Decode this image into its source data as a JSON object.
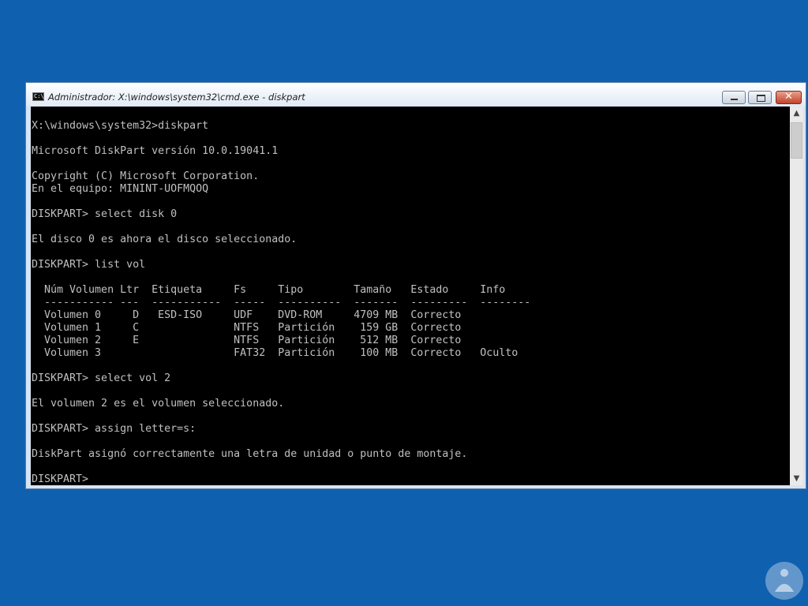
{
  "window": {
    "title": "Administrador: X:\\windows\\system32\\cmd.exe - diskpart",
    "icon_label": "C:\\"
  },
  "console": {
    "lines": [
      {
        "row": 0,
        "text": "X:\\windows\\system32>diskpart"
      },
      {
        "row": 2,
        "text": "Microsoft DiskPart versión 10.0.19041.1"
      },
      {
        "row": 4,
        "text": "Copyright (C) Microsoft Corporation."
      },
      {
        "row": 5,
        "text": "En el equipo: MININT-UOFMQOQ"
      },
      {
        "row": 7,
        "text": "DISKPART> select disk 0"
      },
      {
        "row": 9,
        "text": "El disco 0 es ahora el disco seleccionado."
      },
      {
        "row": 11,
        "text": "DISKPART> list vol"
      },
      {
        "row": 13,
        "text": "  Núm Volumen Ltr  Etiqueta     Fs     Tipo        Tamaño   Estado     Info"
      },
      {
        "row": 14,
        "text": "  ----------- ---  -----------  -----  ----------  -------  ---------  --------"
      },
      {
        "row": 15,
        "text": "  Volumen 0     D   ESD-ISO     UDF    DVD-ROM     4709 MB  Correcto"
      },
      {
        "row": 16,
        "text": "  Volumen 1     C               NTFS   Partición    159 GB  Correcto"
      },
      {
        "row": 17,
        "text": "  Volumen 2     E               NTFS   Partición    512 MB  Correcto"
      },
      {
        "row": 18,
        "text": "  Volumen 3                     FAT32  Partición    100 MB  Correcto   Oculto"
      },
      {
        "row": 20,
        "text": "DISKPART> select vol 2"
      },
      {
        "row": 22,
        "text": "El volumen 2 es el volumen seleccionado."
      },
      {
        "row": 24,
        "text": "DISKPART> assign letter=s:"
      },
      {
        "row": 26,
        "text": "DiskPart asignó correctamente una letra de unidad o punto de montaje."
      },
      {
        "row": 28,
        "text": "DISKPART>"
      }
    ]
  },
  "controls": {
    "close_glyph": "✕",
    "scroll_up_glyph": "▲",
    "scroll_down_glyph": "▼"
  },
  "colors": {
    "desktop": "#1060b0",
    "console_bg": "#000000",
    "console_fg": "#c0c0c0"
  }
}
